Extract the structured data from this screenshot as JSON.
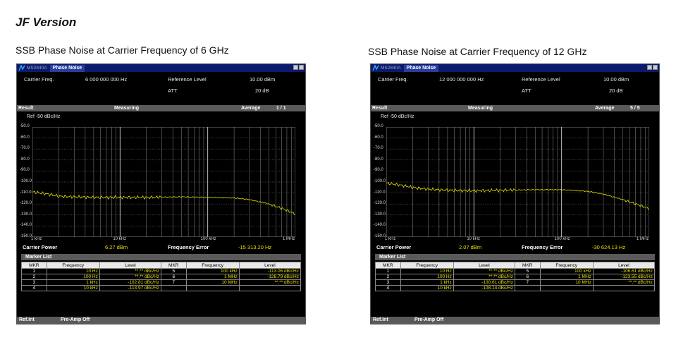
{
  "heading": "JF Version",
  "captions": [
    "SSB Phase Noise at Carrier Frequency of 6 GHz",
    "SSB Phase Noise at Carrier Frequency of 12 GHz"
  ],
  "panels": [
    {
      "model": "MS2840A",
      "window_title": "Phase Noise",
      "carrier_freq_label": "Carrier Freq.",
      "carrier_freq_value": "6 000 000 000 Hz",
      "ref_level_label": "Reference Level",
      "ref_level_value": "10.00 dBm",
      "att_label": "ATT",
      "att_value": "20 dB",
      "result_label": "Result",
      "status": "Measuring",
      "average_label": "Average",
      "average_value": "1 /    1",
      "ref_label": "Ref     -50 dBc/Hz",
      "carrier_power_label": "Carrier Power",
      "carrier_power_value": "6.27 dBm",
      "freq_error_label": "Frequency Error",
      "freq_error_value": "-15 313.20 Hz",
      "marker_list_label": "Marker List",
      "marker_headers": [
        "MKR",
        "Frequency",
        "Level",
        "MKR",
        "Frequency",
        "Level"
      ],
      "markers_left": [
        {
          "n": "1",
          "f": "10 Hz",
          "l": "**.** dBc/Hz"
        },
        {
          "n": "2",
          "f": "100 Hz",
          "l": "**.** dBc/Hz"
        },
        {
          "n": "3",
          "f": "1 kHz",
          "l": "-102.81 dBc/Hz"
        },
        {
          "n": "4",
          "f": "10 kHz",
          "l": "-113.97 dBc/Hz"
        }
      ],
      "markers_right": [
        {
          "n": "5",
          "f": "100 kHz",
          "l": "-113.06 dBc/Hz"
        },
        {
          "n": "6",
          "f": "1 MHz",
          "l": "-128.79 dBc/Hz"
        },
        {
          "n": "7",
          "f": "10 MHz",
          "l": "**.** dBc/Hz"
        },
        {
          "n": "",
          "f": "",
          "l": ""
        }
      ],
      "footer_left": "Ref.Int",
      "footer_right": "Pre-Amp Off"
    },
    {
      "model": "MS2840A",
      "window_title": "Phase Noise",
      "carrier_freq_label": "Carrier Freq.",
      "carrier_freq_value": "12 000 000 000 Hz",
      "ref_level_label": "Reference Level",
      "ref_level_value": "10.00 dBm",
      "att_label": "ATT",
      "att_value": "20 dB",
      "result_label": "Result",
      "status": "Measuring",
      "average_label": "Average",
      "average_value": "5 /    5",
      "ref_label": "Ref     -50 dBc/Hz",
      "carrier_power_label": "Carrier Power",
      "carrier_power_value": "2.07 dBm",
      "freq_error_label": "Frequency Error",
      "freq_error_value": "-30 624.13 Hz",
      "marker_list_label": "Marker List",
      "marker_headers": [
        "MKR",
        "Frequency",
        "Level",
        "MKR",
        "Frequency",
        "Level"
      ],
      "markers_left": [
        {
          "n": "1",
          "f": "10 Hz",
          "l": "**.** dBc/Hz"
        },
        {
          "n": "2",
          "f": "100 Hz",
          "l": "**.** dBc/Hz"
        },
        {
          "n": "3",
          "f": "1 kHz",
          "l": "-100.61 dBc/Hz"
        },
        {
          "n": "4",
          "f": "10 kHz",
          "l": "-108.14 dBc/Hz"
        }
      ],
      "markers_right": [
        {
          "n": "5",
          "f": "100 kHz",
          "l": "-106.61 dBc/Hz"
        },
        {
          "n": "6",
          "f": "1 MHz",
          "l": "-123.55 dBc/Hz"
        },
        {
          "n": "7",
          "f": "10 MHz",
          "l": "**.** dBc/Hz"
        },
        {
          "n": "",
          "f": "",
          "l": ""
        }
      ],
      "footer_left": "Ref.Int",
      "footer_right": "Pre-Amp Off"
    }
  ],
  "chart_data": [
    {
      "type": "line",
      "x_scale": "log",
      "xlim": [
        1000,
        1000000
      ],
      "ylim": [
        -150,
        -50
      ],
      "y_ticks": [
        "-50.0",
        "-60.0",
        "-70.0",
        "-80.0",
        "-90.0",
        "-100.0",
        "-110.0",
        "-120.0",
        "-130.0",
        "-140.0",
        "-150.0"
      ],
      "x_ticks": [
        "1 kHz",
        "10 kHz",
        "100 kHz",
        "1 MHz"
      ],
      "grid": true,
      "trace_color": "#e0e000",
      "series": [
        {
          "x": [
            1000,
            1500,
            2000,
            3000,
            5000,
            10000,
            20000,
            50000,
            100000,
            200000,
            300000,
            500000,
            700000,
            1000000
          ],
          "y": [
            -109,
            -111,
            -113,
            -113.5,
            -114,
            -114,
            -114,
            -113.5,
            -114,
            -114.5,
            -116,
            -120,
            -124,
            -129
          ]
        }
      ]
    },
    {
      "type": "line",
      "x_scale": "log",
      "xlim": [
        1000,
        1000000
      ],
      "ylim": [
        -150,
        -50
      ],
      "y_ticks": [
        "-50.0",
        "-60.0",
        "-70.0",
        "-80.0",
        "-90.0",
        "-100.0",
        "-110.0",
        "-120.0",
        "-130.0",
        "-140.0",
        "-150.0"
      ],
      "x_ticks": [
        "1 kHz",
        "10 kHz",
        "100 kHz",
        "1 MHz"
      ],
      "grid": true,
      "trace_color": "#e0e000",
      "series": [
        {
          "x": [
            1000,
            1500,
            2000,
            3000,
            5000,
            10000,
            20000,
            50000,
            100000,
            200000,
            300000,
            500000,
            700000,
            1000000
          ],
          "y": [
            -101,
            -103,
            -105,
            -106.5,
            -107.5,
            -108,
            -107.5,
            -107,
            -107,
            -108.5,
            -111,
            -116,
            -120,
            -124
          ]
        }
      ]
    }
  ]
}
